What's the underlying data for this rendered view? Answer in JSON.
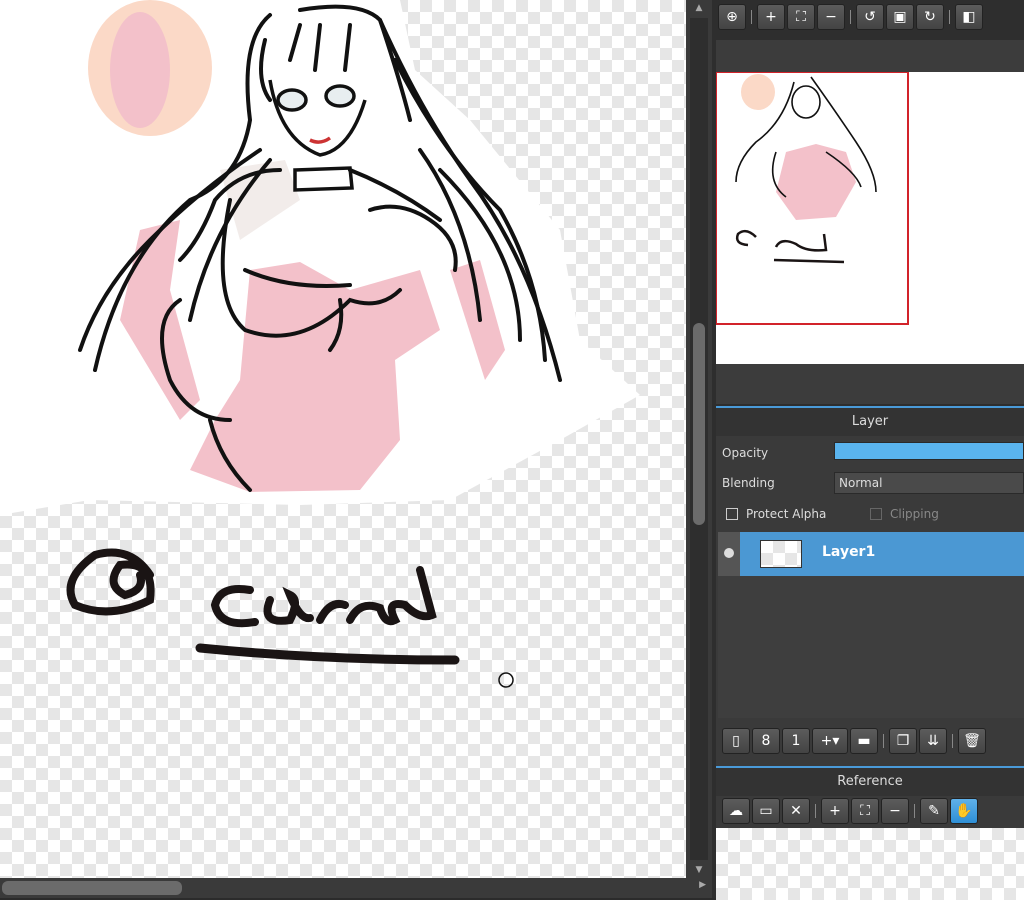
{
  "canvas": {
    "signature_text": "@ card"
  },
  "view_toolbar": {
    "icons": [
      "zoom-actual-icon",
      "zoom-in-icon",
      "fit-icon",
      "zoom-out-icon",
      "rotate-left-icon",
      "reset-view-icon",
      "rotate-right-icon",
      "flip-icon"
    ]
  },
  "layer_panel": {
    "title": "Layer",
    "opacity_label": "Opacity",
    "opacity_value": 100,
    "blending_label": "Blending",
    "blending_value": "Normal",
    "protect_alpha_label": "Protect Alpha",
    "clipping_label": "Clipping",
    "layers": [
      {
        "name": "Layer1",
        "selected": true
      }
    ],
    "bottom_icons": [
      "new-layer-icon",
      "new-layer-8bit-icon",
      "new-layer-1bit-icon",
      "add-layer-menu-icon",
      "new-folder-icon",
      "duplicate-layer-icon",
      "merge-layer-icon",
      "delete-layer-icon"
    ]
  },
  "reference_panel": {
    "title": "Reference",
    "icons": [
      "upload-icon",
      "open-folder-icon",
      "close-icon",
      "zoom-in-icon",
      "fit-icon",
      "zoom-out-icon",
      "eyedropper-icon",
      "hand-icon"
    ]
  },
  "colors": {
    "accent": "#4b98d3",
    "panel_bg": "#2e2e2e",
    "skin_pink": "#f3c1ca"
  }
}
